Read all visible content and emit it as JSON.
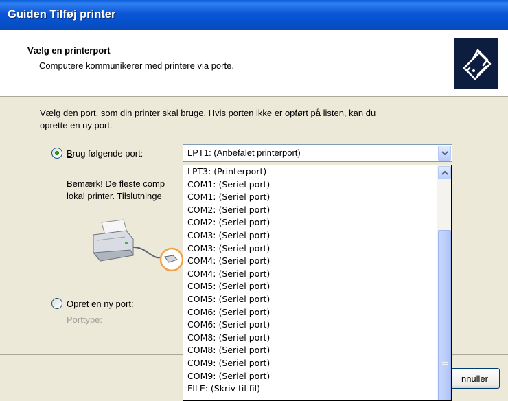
{
  "window": {
    "title": "Guiden Tilføj printer"
  },
  "header": {
    "title": "Vælg en printerport",
    "subtitle": "Computere kommunikerer med printere via porte.",
    "icon": "printer-wizard-icon"
  },
  "intro": {
    "line1": "Vælg den port, som din printer skal bruge. Hvis porten ikke er opført på listen, kan du",
    "line2": "oprette en ny port."
  },
  "use_port": {
    "access_key": "B",
    "label_rest": "rug følgende port:",
    "selected": true
  },
  "port_combo": {
    "value": "LPT1: (Anbefalet printerport)"
  },
  "note": {
    "line1": "Bemærk! De fleste comp",
    "line2": "lokal printer. Tilslutninge"
  },
  "create_port": {
    "access_key": "O",
    "label_rest": "pret en ny port:",
    "selected": false
  },
  "port_type_label": "Porttype:",
  "cancel_button": {
    "label": "nnuller"
  },
  "dropdown": {
    "items": [
      "LPT3: (Printerport)",
      "COM1: (Seriel port)",
      "COM1: (Seriel port)",
      "COM2: (Seriel port)",
      "COM2: (Seriel port)",
      "COM3: (Seriel port)",
      "COM3: (Seriel port)",
      "COM4: (Seriel port)",
      "COM4: (Seriel port)",
      "COM5: (Seriel port)",
      "COM5: (Seriel port)",
      "COM6: (Seriel port)",
      "COM6: (Seriel port)",
      "COM8: (Seriel port)",
      "COM8: (Seriel port)",
      "COM9: (Seriel port)",
      "COM9: (Seriel port)",
      "FILE: (Skriv til fil)"
    ]
  },
  "colors": {
    "titlebar": "#0550c8",
    "dialog_bg": "#ece9d8",
    "radio_dot": "#21a121"
  }
}
